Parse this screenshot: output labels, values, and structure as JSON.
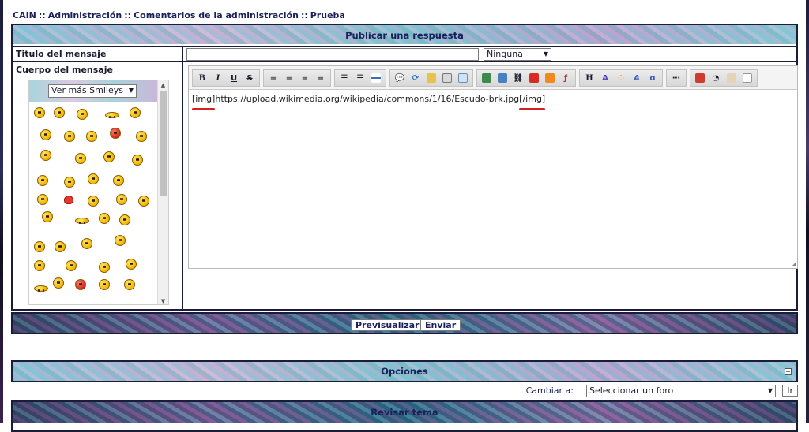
{
  "breadcrumb": {
    "items": [
      "CAIN",
      "Administración",
      "Comentarios de la administración",
      "Prueba"
    ],
    "separator": "::"
  },
  "reply_panel": {
    "header": "Publicar una respuesta",
    "title_label": "Titulo del mensaje",
    "title_value": "",
    "icon_select": "Ninguna",
    "body_label": "Cuerpo del mensaje",
    "smileys_select": "Ver más Smileys"
  },
  "editor": {
    "open_tag": "[img]",
    "url": "https://upload.wikimedia.org/wikipedia/commons/1/16/Escudo-brk.jpg",
    "close_tag": "[/img]",
    "toolbar": {
      "bold": "B",
      "italic": "I",
      "underline": "U",
      "strike": "S",
      "heading": "H",
      "highlight_color": "#d42020"
    }
  },
  "actions": {
    "preview": "Previsualizar",
    "send": "Enviar"
  },
  "options_panel": {
    "header": "Opciones",
    "expand": "+"
  },
  "forum_jump": {
    "label": "Cambiar a:",
    "select": "Seleccionar un foro",
    "go": "Ir"
  },
  "review_panel": {
    "header": "Revisar tema"
  }
}
